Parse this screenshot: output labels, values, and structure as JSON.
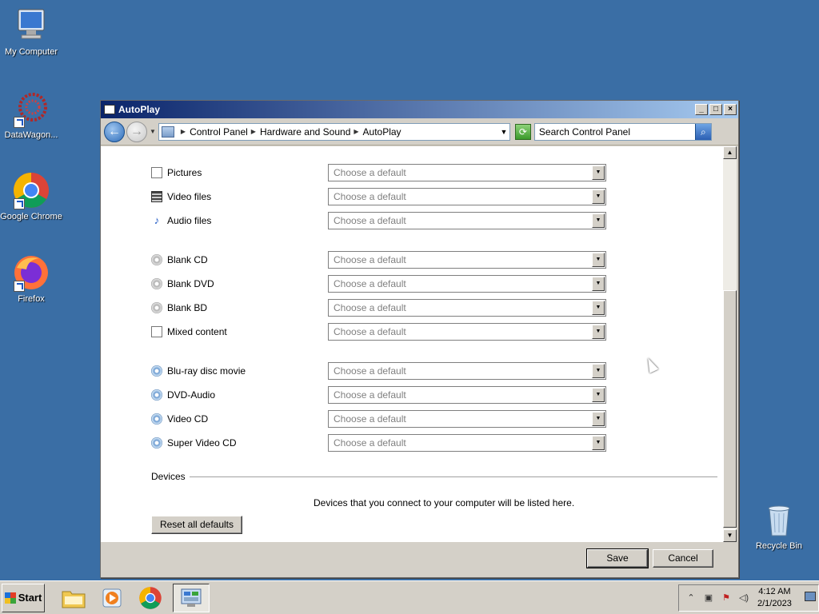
{
  "desktop": {
    "icons": [
      {
        "label": "My Computer",
        "icon": "computer-icon"
      },
      {
        "label": "DataWagon...",
        "icon": "datawagon-icon"
      },
      {
        "label": "Google Chrome",
        "icon": "chrome-icon"
      },
      {
        "label": "Firefox",
        "icon": "firefox-icon"
      },
      {
        "label": "Recycle Bin",
        "icon": "recycle-bin-icon"
      }
    ]
  },
  "window": {
    "title": "AutoPlay",
    "address": {
      "crumbs": [
        "Control Panel",
        "Hardware and Sound",
        "AutoPlay"
      ]
    },
    "search": {
      "placeholder": "Search Control Panel"
    },
    "media_rows": [
      {
        "label": "Pictures",
        "value": "Choose a default",
        "icon": "pictures-icon"
      },
      {
        "label": "Video files",
        "value": "Choose a default",
        "icon": "video-files-icon"
      },
      {
        "label": "Audio files",
        "value": "Choose a default",
        "icon": "audio-files-icon"
      },
      {
        "label": "Blank CD",
        "value": "Choose a default",
        "icon": "blank-cd-icon"
      },
      {
        "label": "Blank DVD",
        "value": "Choose a default",
        "icon": "blank-dvd-icon"
      },
      {
        "label": "Blank BD",
        "value": "Choose a default",
        "icon": "blank-bd-icon"
      },
      {
        "label": "Mixed content",
        "value": "Choose a default",
        "icon": "mixed-content-icon"
      },
      {
        "label": "Blu-ray disc movie",
        "value": "Choose a default",
        "icon": "bluray-icon"
      },
      {
        "label": "DVD-Audio",
        "value": "Choose a default",
        "icon": "dvd-audio-icon"
      },
      {
        "label": "Video CD",
        "value": "Choose a default",
        "icon": "video-cd-icon"
      },
      {
        "label": "Super Video CD",
        "value": "Choose a default",
        "icon": "super-video-cd-icon"
      }
    ],
    "devices_heading": "Devices",
    "devices_text": "Devices that you connect to your computer will be listed here.",
    "reset_label": "Reset all defaults",
    "save_label": "Save",
    "cancel_label": "Cancel"
  },
  "taskbar": {
    "start_label": "Start",
    "clock_time": "4:12 AM",
    "clock_date": "2/1/2023"
  }
}
